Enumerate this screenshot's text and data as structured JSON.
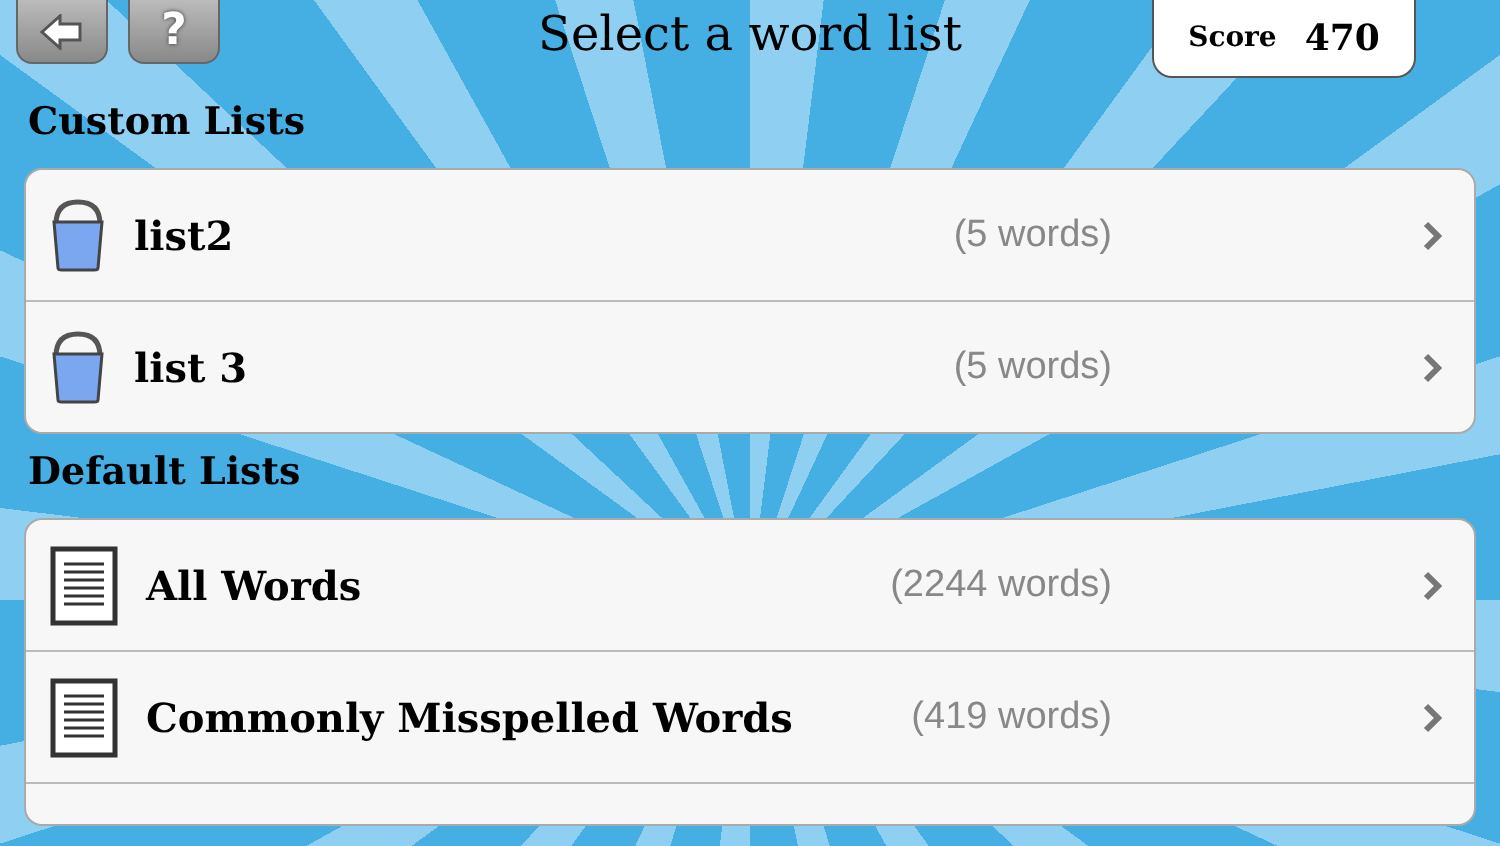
{
  "toolbar": {
    "help_label": "?",
    "title": "Select a word list",
    "score": {
      "label": "Score",
      "value": "470"
    }
  },
  "sections": [
    {
      "title": "Custom Lists",
      "items": [
        {
          "kind": "bucket",
          "name": "list2",
          "count": "(5 words)"
        },
        {
          "kind": "bucket",
          "name": "list 3",
          "count": "(5 words)"
        }
      ]
    },
    {
      "title": "Default Lists",
      "items": [
        {
          "kind": "document",
          "name": "All Words",
          "count": "(2244 words)"
        },
        {
          "kind": "document",
          "name": "Commonly Misspelled Words",
          "count": "(419 words)"
        }
      ]
    }
  ]
}
